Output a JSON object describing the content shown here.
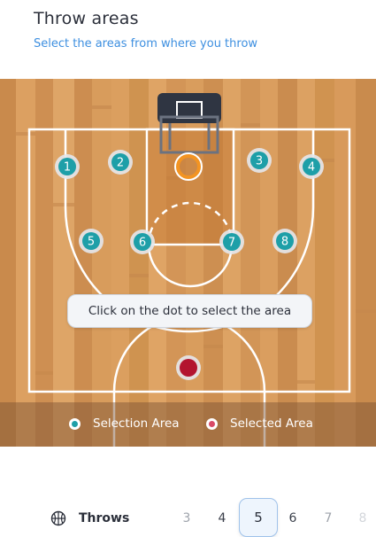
{
  "header": {
    "title": "Throw areas",
    "subtitle": "Select the areas from where you throw"
  },
  "court": {
    "spots": [
      {
        "label": "1",
        "state": "selection"
      },
      {
        "label": "2",
        "state": "selection"
      },
      {
        "label": "3",
        "state": "selection"
      },
      {
        "label": "4",
        "state": "selection"
      },
      {
        "label": "5",
        "state": "selection"
      },
      {
        "label": "6",
        "state": "selection"
      },
      {
        "label": "7",
        "state": "selection"
      },
      {
        "label": "8",
        "state": "selection"
      },
      {
        "label": "",
        "state": "selected"
      }
    ],
    "tooltip": "Click on the dot to select the area"
  },
  "legend": {
    "selection_label": "Selection Area",
    "selected_label": "Selected Area"
  },
  "throws": {
    "label": "Throws",
    "options": [
      "3",
      "4",
      "5",
      "6",
      "7",
      "8"
    ],
    "selected": "5"
  },
  "colors": {
    "teal": "#1e9fa8",
    "selected_red": "#b3142f",
    "accent_blue": "#3d8fe0",
    "rim_orange": "#f39422"
  }
}
